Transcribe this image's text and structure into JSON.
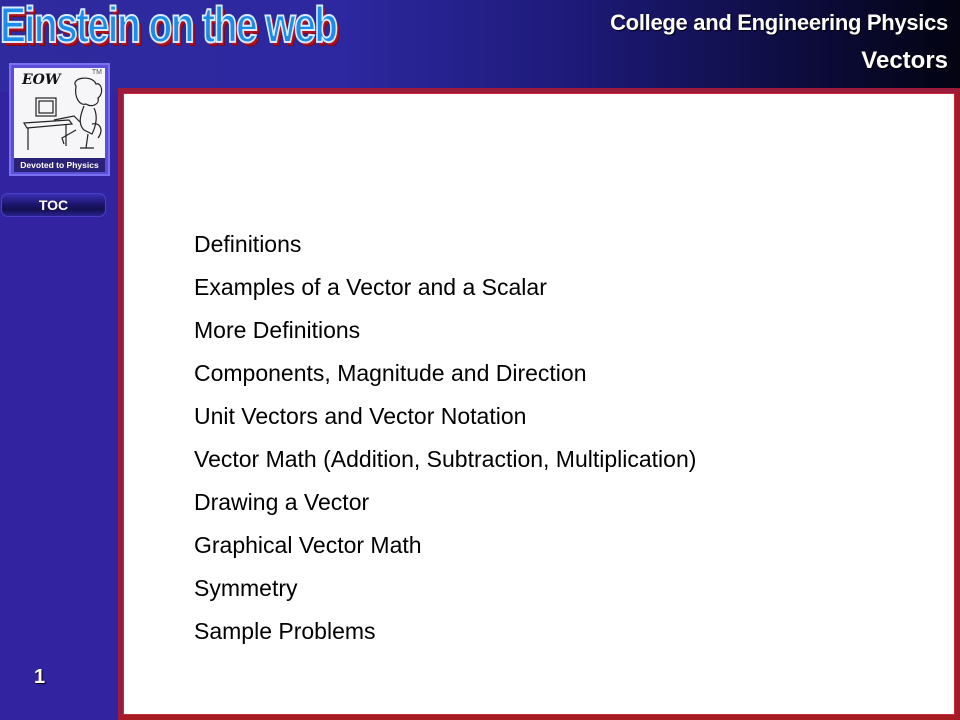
{
  "header": {
    "brand": "Einstein on the web",
    "title": "College and Engineering Physics",
    "subtitle": "Vectors"
  },
  "sidebar": {
    "logo": {
      "mark": "EOW",
      "trademark": "TM",
      "caption": "Devoted to Physics"
    },
    "toc_label": "TOC",
    "page_number": "1"
  },
  "colors": {
    "brand_blue": "#1d8be8",
    "panel_border": "#9c1a3a",
    "sidebar_bg": "#3223a0",
    "header_dark": "#030311"
  },
  "toc": {
    "items": [
      {
        "label": "Definitions"
      },
      {
        "label": "Examples of a Vector and a Scalar"
      },
      {
        "label": "More Definitions"
      },
      {
        "label": "Components, Magnitude and Direction"
      },
      {
        "label": "Unit Vectors and Vector Notation"
      },
      {
        "label": "Vector Math (Addition, Subtraction, Multiplication)"
      },
      {
        "label": "Drawing a Vector"
      },
      {
        "label": "Graphical Vector Math"
      },
      {
        "label": "Symmetry"
      },
      {
        "label": "Sample Problems"
      }
    ]
  }
}
